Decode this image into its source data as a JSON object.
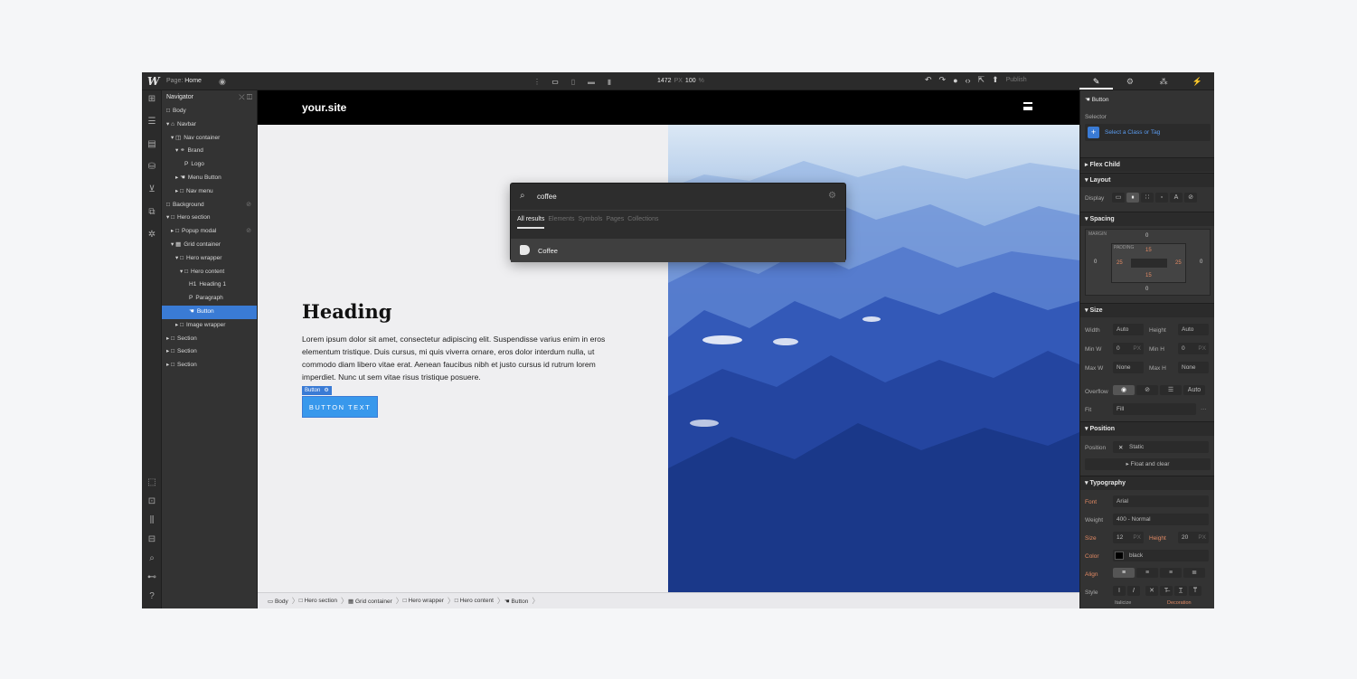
{
  "topbar": {
    "logo": "W",
    "page_prefix": "Page:",
    "page_name": "Home",
    "viewport_width": "1472",
    "viewport_unit": "PX",
    "zoom": "100",
    "zoom_unit": "%",
    "publish_label": "Publish"
  },
  "navigator": {
    "title": "Navigator",
    "items": [
      {
        "label": "Body",
        "icon": "□",
        "indent": 0
      },
      {
        "label": "Navbar",
        "icon": "▾ ⌂",
        "indent": 0
      },
      {
        "label": "Nav container",
        "icon": "▾ ◫",
        "indent": 1
      },
      {
        "label": "Brand",
        "icon": "▾ ⚭",
        "indent": 2
      },
      {
        "label": "Logo",
        "icon": "P",
        "indent": 4
      },
      {
        "label": "Menu Button",
        "icon": "▸ ☚",
        "indent": 2
      },
      {
        "label": "Nav menu",
        "icon": "▸ □",
        "indent": 2
      },
      {
        "label": "Background",
        "icon": "□",
        "indent": 0
      },
      {
        "label": "Hero section",
        "icon": "▾ □",
        "indent": 0
      },
      {
        "label": "Popup modal",
        "icon": "▸ □",
        "indent": 1
      },
      {
        "label": "Grid container",
        "icon": "▾ ▦",
        "indent": 1
      },
      {
        "label": "Hero wrapper",
        "icon": "▾ □",
        "indent": 2
      },
      {
        "label": "Hero content",
        "icon": "▾ □",
        "indent": 3
      },
      {
        "label": "Heading 1",
        "icon": "H1",
        "indent": 5
      },
      {
        "label": "Paragraph",
        "icon": "P",
        "indent": 5
      },
      {
        "label": "Button",
        "icon": "☚",
        "indent": 5
      },
      {
        "label": "Image wrapper",
        "icon": "▸ □",
        "indent": 2
      },
      {
        "label": "Section",
        "icon": "▸ □",
        "indent": 0
      },
      {
        "label": "Section",
        "icon": "▸ □",
        "indent": 0
      },
      {
        "label": "Section",
        "icon": "▸ □",
        "indent": 0
      }
    ]
  },
  "site": {
    "logo": "your.site",
    "heading": "Heading",
    "paragraph": "Lorem ipsum dolor sit amet, consectetur adipiscing elit. Suspendisse varius enim in eros elementum tristique. Duis cursus, mi quis viverra ornare, eros dolor interdum nulla, ut commodo diam libero vitae erat. Aenean faucibus nibh et justo cursus id rutrum lorem imperdiet. Nunc ut sem vitae risus tristique posuere.",
    "selected_tag": "Button",
    "button_text": "BUTTON TEXT"
  },
  "search": {
    "query": "coffee",
    "filters": [
      "All results",
      "Elements",
      "Symbols",
      "Pages",
      "Collections"
    ],
    "active_filter": "All results",
    "results": [
      {
        "label": "Coffee",
        "icon": "cup-icon"
      }
    ]
  },
  "breadcrumbs": [
    "Body",
    "Hero section",
    "Grid container",
    "Hero wrapper",
    "Hero content",
    "Button"
  ],
  "style_panel": {
    "element": "Button",
    "selector_label": "Selector",
    "selector_placeholder": "Select a Class or Tag",
    "sections": {
      "flex_child": "Flex Child",
      "layout": "Layout",
      "spacing": "Spacing",
      "size": "Size",
      "position": "Position",
      "typography": "Typography"
    },
    "display_label": "Display",
    "spacing": {
      "margin_label": "MARGIN",
      "padding_label": "PADDING",
      "margin": {
        "top": "0",
        "right": "0",
        "bottom": "0",
        "left": "0"
      },
      "padding": {
        "top": "15",
        "right": "25",
        "bottom": "15",
        "left": "25"
      }
    },
    "size": {
      "width_label": "Width",
      "width": "Auto",
      "height_label": "Height",
      "height": "Auto",
      "minw_label": "Min W",
      "minw": "0",
      "minw_unit": "PX",
      "minh_label": "Min H",
      "minh": "0",
      "minh_unit": "PX",
      "maxw_label": "Max W",
      "maxw": "None",
      "maxh_label": "Max H",
      "maxh": "None",
      "overflow_label": "Overflow",
      "overflow_auto": "Auto",
      "fit_label": "Fit",
      "fit": "Fill"
    },
    "position": {
      "label": "Position",
      "value": "Static",
      "float_label": "Float and clear"
    },
    "typography": {
      "font_label": "Font",
      "font": "Arial",
      "weight_label": "Weight",
      "weight": "400 - Normal",
      "size_label": "Size",
      "size": "12",
      "size_unit": "PX",
      "height_label": "Height",
      "line_height": "20",
      "line_height_unit": "PX",
      "color_label": "Color",
      "color": "black",
      "align_label": "Align",
      "style_label": "Style",
      "italicize_label": "Italicize",
      "decoration_label": "Decoration"
    }
  },
  "colors": {
    "accent": "#3a7bd5",
    "button": "#3898ec",
    "highlight": "#e28a64"
  }
}
